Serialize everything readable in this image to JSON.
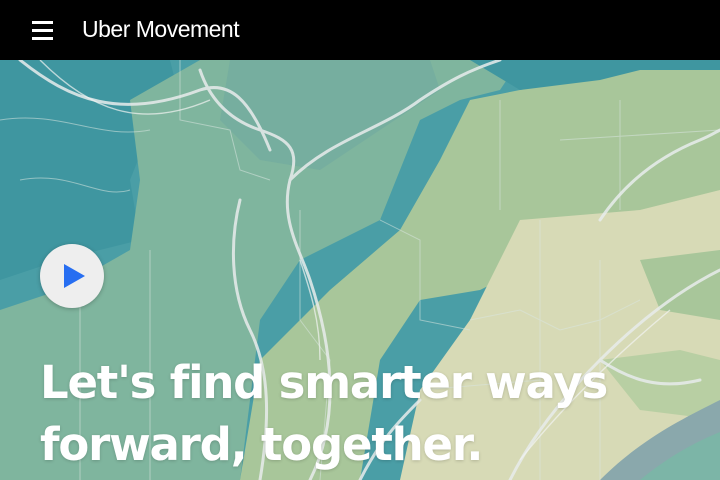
{
  "header": {
    "brand": "Uber Movement",
    "menu_icon": "hamburger-menu-icon"
  },
  "hero": {
    "headline_line1": "Let's find smarter ways",
    "headline_line2": "forward, together.",
    "play_icon": "play-icon"
  },
  "colors": {
    "header_bg": "#000000",
    "map_teal": "#3f9ba3",
    "map_green": "#7fb59c",
    "map_light_green": "#a9c79a",
    "map_beige": "#d8dcb7",
    "play_accent": "#276ef1"
  }
}
